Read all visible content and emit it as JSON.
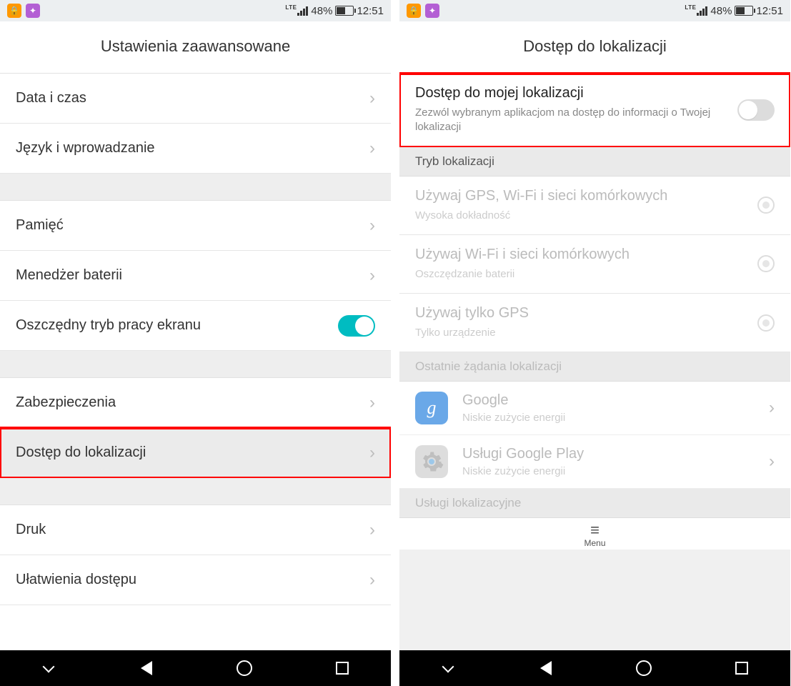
{
  "status": {
    "lte": "LTE",
    "battery_pct": "48%",
    "time": "12:51"
  },
  "left": {
    "title": "Ustawienia zaawansowane",
    "rows": {
      "date_time": "Data i czas",
      "language": "Język i wprowadzanie",
      "memory": "Pamięć",
      "battery_mgr": "Menedżer baterii",
      "eco_screen": "Oszczędny tryb pracy ekranu",
      "security": "Zabezpieczenia",
      "location": "Dostęp do lokalizacji",
      "print": "Druk",
      "accessibility": "Ułatwienia dostępu"
    }
  },
  "right": {
    "title": "Dostęp do lokalizacji",
    "access": {
      "title": "Dostęp do mojej lokalizacji",
      "sub": "Zezwól wybranym aplikacjom na dostęp do informacji o Twojej lokalizacji"
    },
    "mode_header": "Tryb lokalizacji",
    "modes": {
      "gps_wifi_cell": {
        "title": "Używaj GPS, Wi-Fi i sieci komórkowych",
        "sub": "Wysoka dokładność"
      },
      "wifi_cell": {
        "title": "Używaj Wi-Fi i sieci komórkowych",
        "sub": "Oszczędzanie baterii"
      },
      "gps_only": {
        "title": "Używaj tylko GPS",
        "sub": "Tylko urządzenie"
      }
    },
    "recent_header": "Ostatnie żądania lokalizacji",
    "apps": {
      "google": {
        "title": "Google",
        "sub": "Niskie zużycie energii"
      },
      "play_services": {
        "title": "Usługi Google Play",
        "sub": "Niskie zużycie energii"
      }
    },
    "services_header": "Usługi lokalizacyjne",
    "menu_label": "Menu"
  }
}
